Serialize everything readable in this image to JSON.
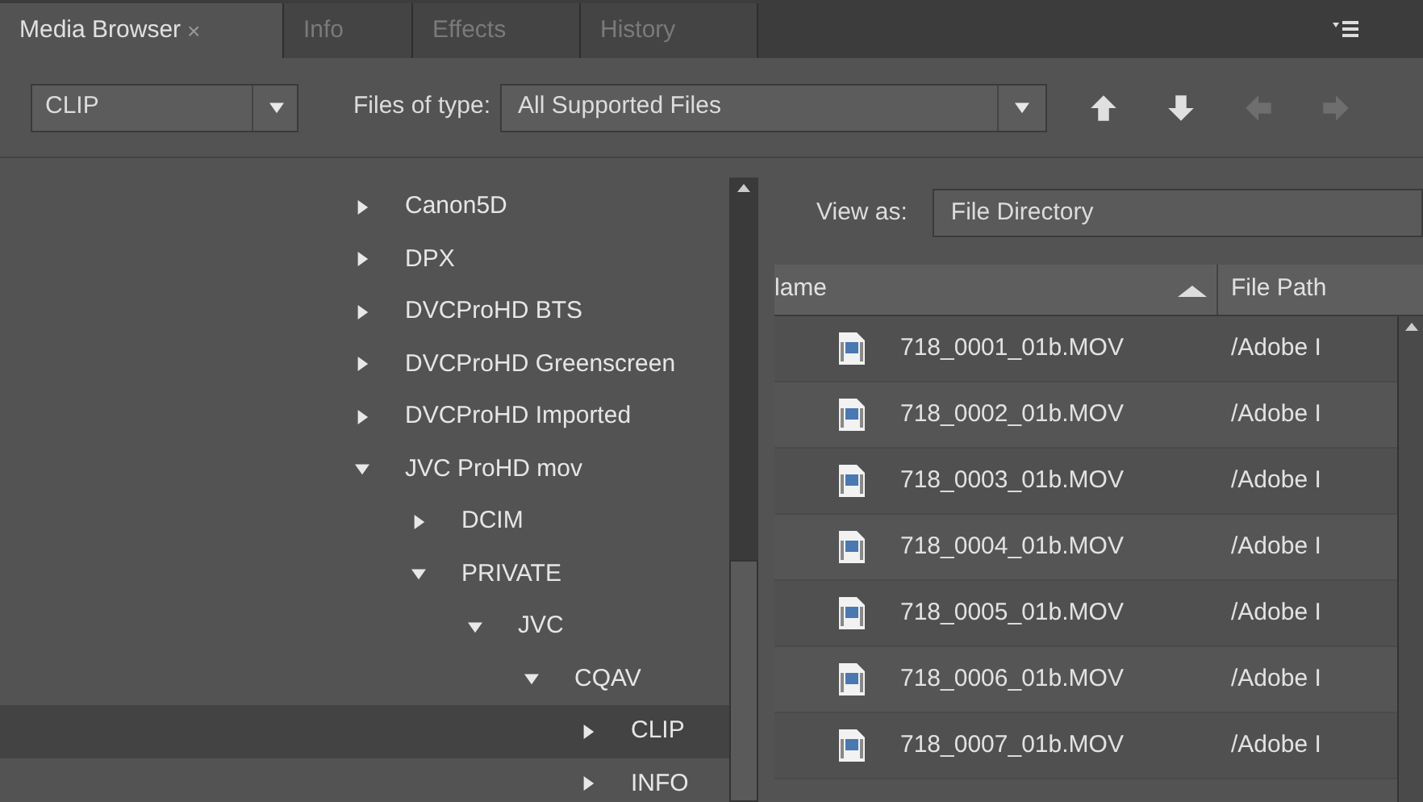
{
  "tabs": [
    {
      "label": "Media Browser",
      "close": "×",
      "selected": true
    },
    {
      "label": "Info",
      "selected": false
    },
    {
      "label": "Effects",
      "selected": false
    },
    {
      "label": "History",
      "selected": false
    }
  ],
  "toolbar": {
    "location": "CLIP",
    "files_of_type_label": "Files of type:",
    "files_of_type": "All Supported Files",
    "up_enabled": true,
    "down_enabled": true,
    "back_enabled": false,
    "forward_enabled": false
  },
  "tree": [
    {
      "label": "Canon5D",
      "expanded": false,
      "selected": false
    },
    {
      "label": "DPX",
      "expanded": false,
      "selected": false
    },
    {
      "label": "DVCProHD BTS",
      "expanded": false,
      "selected": false
    },
    {
      "label": "DVCProHD Greenscreen",
      "expanded": false,
      "selected": false
    },
    {
      "label": "DVCProHD Imported",
      "expanded": false,
      "selected": false
    },
    {
      "label": "JVC ProHD mov",
      "expanded": true,
      "selected": false,
      "children": [
        {
          "label": "DCIM",
          "expanded": false,
          "selected": false
        },
        {
          "label": "PRIVATE",
          "expanded": true,
          "selected": false,
          "children": [
            {
              "label": "JVC",
              "expanded": true,
              "selected": false,
              "children": [
                {
                  "label": "CQAV",
                  "expanded": true,
                  "selected": false,
                  "children": [
                    {
                      "label": "CLIP",
                      "expanded": false,
                      "selected": true
                    },
                    {
                      "label": "INFO",
                      "expanded": false,
                      "selected": false
                    }
                  ]
                }
              ]
            }
          ]
        }
      ]
    }
  ],
  "view_as": {
    "label": "View as:",
    "value": "File Directory"
  },
  "table": {
    "columns": [
      "lame",
      "File Path"
    ],
    "rows": [
      {
        "name": "718_0001_01b.MOV",
        "path": "/Adobe I"
      },
      {
        "name": "718_0002_01b.MOV",
        "path": "/Adobe I"
      },
      {
        "name": "718_0003_01b.MOV",
        "path": "/Adobe I"
      },
      {
        "name": "718_0004_01b.MOV",
        "path": "/Adobe I"
      },
      {
        "name": "718_0005_01b.MOV",
        "path": "/Adobe I"
      },
      {
        "name": "718_0006_01b.MOV",
        "path": "/Adobe I"
      },
      {
        "name": "718_0007_01b.MOV",
        "path": "/Adobe I"
      }
    ]
  }
}
